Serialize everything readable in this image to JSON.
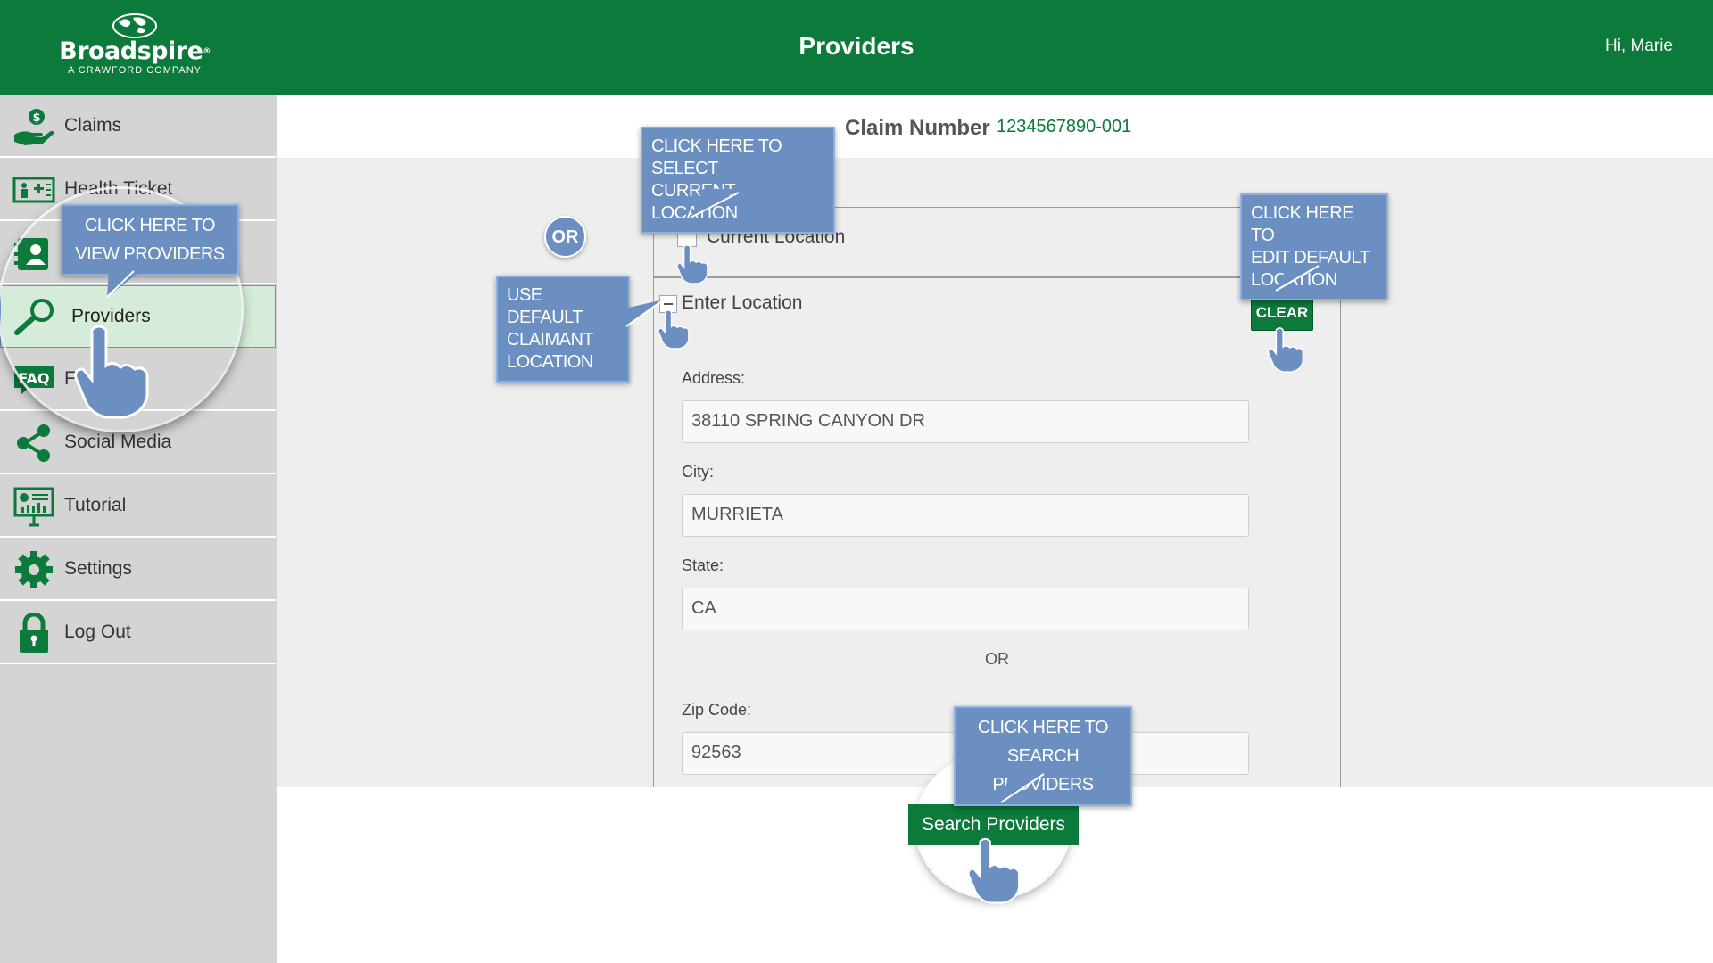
{
  "header": {
    "logo": {
      "brand": "Broadspire",
      "registered": "®",
      "tagline": "A CRAWFORD COMPANY"
    },
    "title": "Providers",
    "greeting": "Hi, Marie",
    "color": "#0b7a3a"
  },
  "sidebar": {
    "items": [
      {
        "label": "Claims",
        "icon": "hand-dollar-icon"
      },
      {
        "label": "Health Ticket",
        "icon": "health-ticket-icon"
      },
      {
        "label": "",
        "icon": "contacts-icon"
      },
      {
        "label": "Providers",
        "icon": "magnifier-icon",
        "active": true
      },
      {
        "label": "F",
        "icon": "faq-icon",
        "icon_text": "FAQ"
      },
      {
        "label": "Social Media",
        "icon": "share-icon"
      },
      {
        "label": "Tutorial",
        "icon": "presentation-icon"
      },
      {
        "label": "Settings",
        "icon": "gear-icon"
      },
      {
        "label": "Log Out",
        "icon": "lock-icon"
      }
    ]
  },
  "claim": {
    "label": "Claim Number",
    "value": "1234567890-001"
  },
  "location": {
    "current_label": "Current Location",
    "enter_label": "Enter Location",
    "clear_label": "CLEAR",
    "or_text": "OR",
    "fields": {
      "address": {
        "label": "Address:",
        "value": "38110 SPRING CANYON DR"
      },
      "city": {
        "label": "City:",
        "value": "MURRIETA"
      },
      "state": {
        "label": "State:",
        "value": "CA"
      },
      "zip": {
        "label": "Zip Code:",
        "value": "92563"
      }
    }
  },
  "search_button": "Search Providers",
  "tutorial": {
    "or_bubble": "OR",
    "view_providers": [
      "CLICK HERE TO",
      "VIEW PROVIDERS"
    ],
    "select_current": [
      "CLICK HERE TO SELECT",
      "CURRENT LOCATION"
    ],
    "edit_default": [
      "CLICK HERE TO",
      "EDIT DEFAULT",
      "LOCATION"
    ],
    "use_default": [
      "USE DEFAULT",
      "CLAIMANT",
      "LOCATION"
    ],
    "search_providers": [
      "CLICK HERE TO",
      "SEARCH PROVIDERS"
    ],
    "callout_color": "#6b8fc0"
  }
}
